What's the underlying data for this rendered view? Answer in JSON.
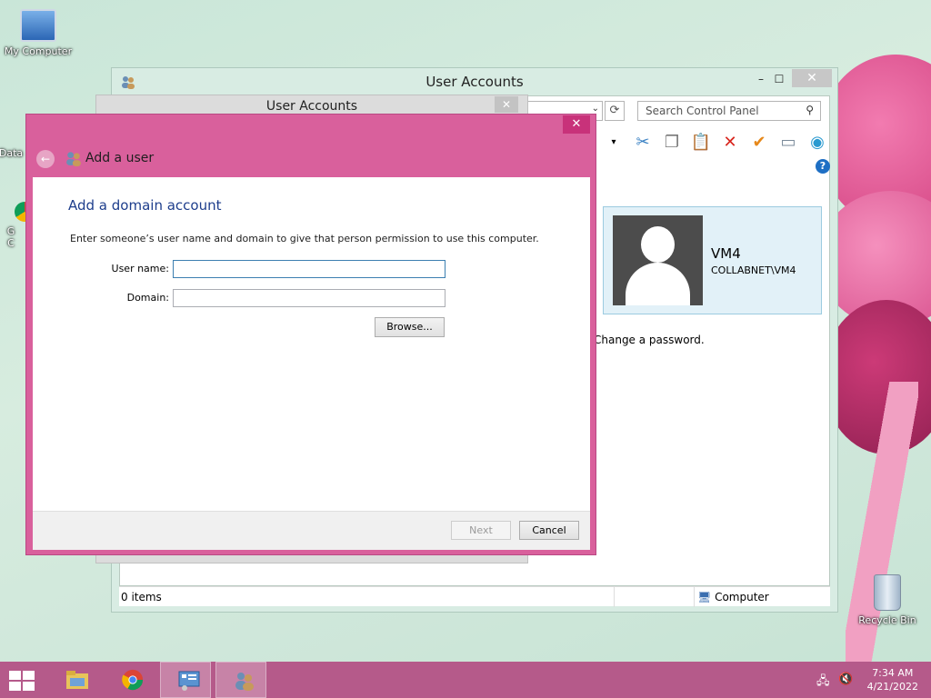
{
  "desktop": {
    "icons": [
      {
        "label": "My Computer",
        "icon": "computer-icon"
      },
      {
        "label": "Recycle Bin",
        "icon": "recycle-bin-icon"
      }
    ],
    "partial_labels": [
      "Data",
      "G",
      "C"
    ]
  },
  "main_window": {
    "title": "User Accounts",
    "search_placeholder": "Search Control Panel",
    "user": {
      "name": "VM4",
      "domain": "COLLABNET\\VM4"
    },
    "change_password_text": "Change a password.",
    "status": {
      "items": "0 items",
      "location": "Computer"
    }
  },
  "mid_window": {
    "title": "User Accounts"
  },
  "dialog": {
    "title": "Add a user",
    "heading": "Add a domain account",
    "description": "Enter someone’s user name and domain to give that person permission to use this computer.",
    "username_label": "User name:",
    "username_value": "",
    "domain_label": "Domain:",
    "domain_value": "",
    "browse_label": "Browse...",
    "next_label": "Next",
    "cancel_label": "Cancel"
  },
  "taskbar": {
    "time": "7:34 AM",
    "date": "4/21/2022"
  },
  "colors": {
    "dialog_accent": "#d9609c",
    "taskbar": "#b55a8a",
    "heading_blue": "#1e3e8c"
  }
}
